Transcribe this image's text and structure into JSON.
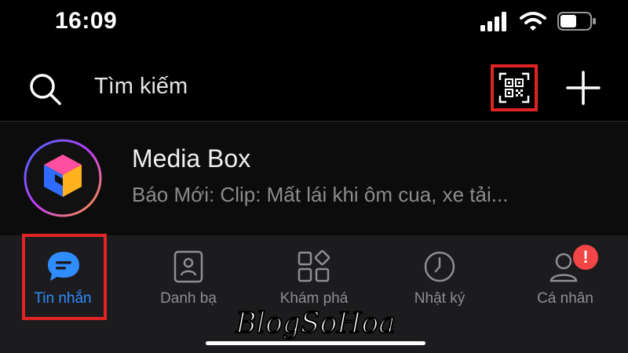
{
  "status_bar": {
    "time": "16:09"
  },
  "header": {
    "search_placeholder": "Tìm kiếm"
  },
  "chat": {
    "name": "Media Box",
    "preview": "Báo Mới: Clip: Mất lái khi ôm cua, xe tải..."
  },
  "tabs": [
    {
      "label": "Tin nhắn",
      "icon": "chat-bubble-icon",
      "active": true
    },
    {
      "label": "Danh bạ",
      "icon": "contacts-icon",
      "active": false
    },
    {
      "label": "Khám phá",
      "icon": "grid-diamond-icon",
      "active": false
    },
    {
      "label": "Nhật ký",
      "icon": "clock-icon",
      "active": false
    },
    {
      "label": "Cá nhân",
      "icon": "person-icon",
      "active": false,
      "badge": "!"
    }
  ],
  "watermark": {
    "text": "BlogSoHoa"
  },
  "colors": {
    "accent": "#2f8cff",
    "highlight": "#e02424",
    "badge": "#f24545"
  }
}
